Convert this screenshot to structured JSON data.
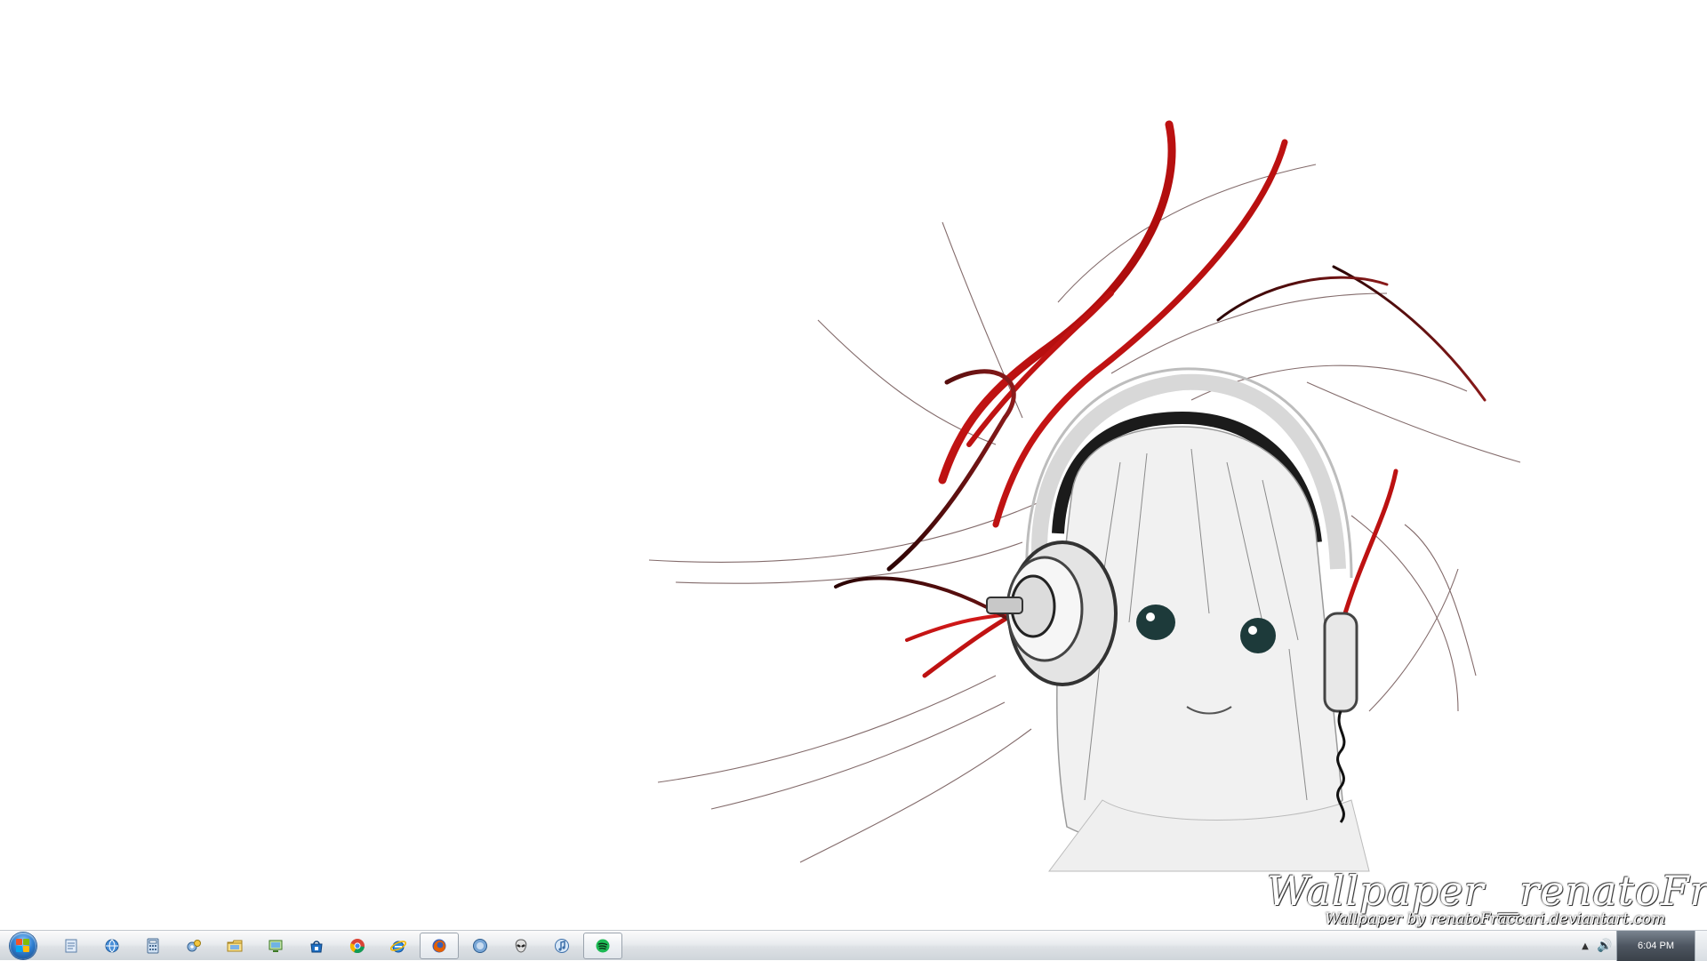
{
  "wallpaper": {
    "watermark_main": "Wallpaper _renatoFraccari",
    "watermark_sub": "Wallpaper by renatoFraccari.deviantart.com",
    "accent_red": "#d51414",
    "accent_dark": "#3a0a0a"
  },
  "taskbar": {
    "start_button_label": "Start",
    "buttons": [
      {
        "name": "notepad",
        "icon": "notepad-icon",
        "active": false
      },
      {
        "name": "network",
        "icon": "network-icon",
        "active": false
      },
      {
        "name": "calculator",
        "icon": "calculator-icon",
        "active": false
      },
      {
        "name": "control-panel",
        "icon": "control-panel-icon",
        "active": false
      },
      {
        "name": "explorer",
        "icon": "folder-icon",
        "active": false
      },
      {
        "name": "remote",
        "icon": "remote-desktop-icon",
        "active": false
      },
      {
        "name": "store",
        "icon": "store-icon",
        "active": false
      },
      {
        "name": "chrome",
        "icon": "chrome-icon",
        "active": false
      },
      {
        "name": "ie",
        "icon": "internet-explorer-icon",
        "active": false
      },
      {
        "name": "firefox",
        "icon": "firefox-icon",
        "active": true
      },
      {
        "name": "globe",
        "icon": "globe-icon",
        "active": false
      },
      {
        "name": "alien",
        "icon": "alien-icon",
        "active": false
      },
      {
        "name": "itunes",
        "icon": "itunes-icon",
        "active": false
      },
      {
        "name": "spotify",
        "icon": "spotify-icon",
        "active": true
      }
    ],
    "tray": {
      "show_hidden_label": "▲",
      "volume_label": "🔊",
      "clock": "6:04 PM"
    }
  }
}
